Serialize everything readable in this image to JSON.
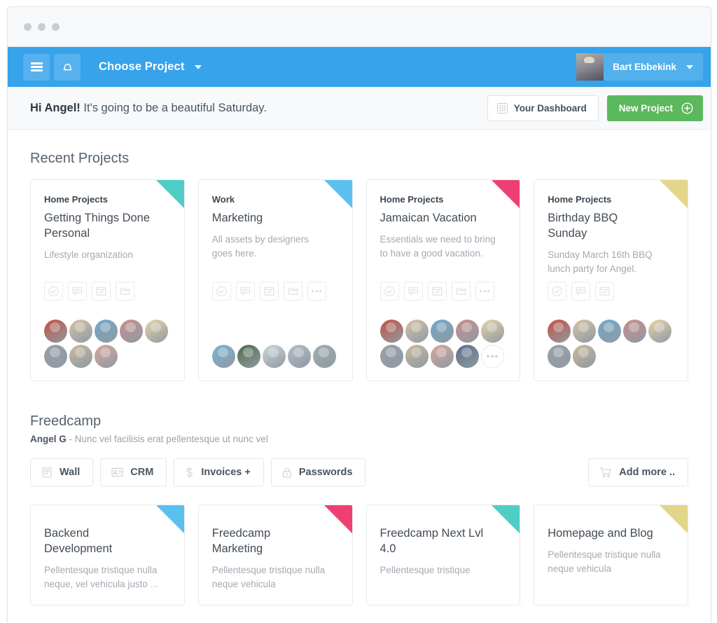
{
  "window": {
    "dots": [
      "minimize-dot",
      "maximize-dot",
      "close-dot"
    ]
  },
  "topbar": {
    "menu_icon": "hamburger-icon",
    "notifications_icon": "bell-icon",
    "choose_project_label": "Choose Project",
    "dropdown_icon": "chevron-down-icon",
    "user_name": "Bart Ebbekink",
    "user_caret_icon": "chevron-down-icon",
    "background_color": "#36a3eb"
  },
  "greeting": {
    "bold": "Hi Angel!",
    "rest": " It's going to be a beautiful Saturday.",
    "dashboard_button": {
      "label": "Your Dashboard",
      "icon": "grid-dots-icon"
    },
    "new_project_button": {
      "label": "New Project",
      "icon": "plus-circle-icon",
      "color": "#5cb85c"
    }
  },
  "recent_projects": {
    "title": "Recent Projects",
    "cards": [
      {
        "group": "Home Projects",
        "title": "Getting Things Done Personal",
        "desc": "Lifestyle organization",
        "ribbon_color": "#4ecdc4",
        "icons": [
          "check-circle-icon",
          "comment-icon",
          "task-icon",
          "folder-icon"
        ],
        "avatar_count": 8,
        "has_more_avatar": false,
        "avatar_colors": [
          "#c4503f",
          "#d8c3a5",
          "#6fa8c9",
          "#c98d8d",
          "#e8d4a8",
          "#9aa0a6",
          "#cbb89d",
          "#d6a89a"
        ]
      },
      {
        "group": "Work",
        "title": "Marketing",
        "desc": "All assets by designers goes here.",
        "ribbon_color": "#5bc0f0",
        "icons": [
          "check-circle-icon",
          "comment-icon",
          "task-icon",
          "folder-icon",
          "more-icon"
        ],
        "avatar_count": 5,
        "has_more_avatar": false,
        "avatar_colors": [
          "#7ab3d6",
          "#4e6b4a",
          "#cfd6dc",
          "#b6bcc4",
          "#9fb0ae"
        ]
      },
      {
        "group": "Home Projects",
        "title": "Jamaican Vacation",
        "desc": "Essentials we need to bring to have a good vacation.",
        "ribbon_color": "#ef3f72",
        "icons": [
          "check-circle-icon",
          "comment-icon",
          "task-icon",
          "folder-icon",
          "more-icon"
        ],
        "avatar_count": 9,
        "has_more_avatar": true,
        "avatar_colors": [
          "#c4503f",
          "#d8c3a5",
          "#6fa8c9",
          "#c98d8d",
          "#e8d4a8",
          "#9aa0a6",
          "#cbb89d",
          "#d6a89a",
          "#5b6d88"
        ]
      },
      {
        "group": "Home Projects",
        "title": "Birthday BBQ Sunday",
        "desc": "Sunday March 16th BBQ lunch party for Angel.",
        "ribbon_color": "#e3d68b",
        "icons": [
          "check-circle-icon",
          "comment-icon",
          "task-icon"
        ],
        "avatar_count": 7,
        "has_more_avatar": false,
        "avatar_colors": [
          "#c4503f",
          "#d8c3a5",
          "#6fa8c9",
          "#c98d8d",
          "#e8d4a8",
          "#9aa0a6",
          "#cbb89d"
        ]
      }
    ]
  },
  "freedcamp": {
    "title": "Freedcamp",
    "owner": "Angel G",
    "owner_desc": " - Nunc vel facilisis erat pellentesque ut nunc vel",
    "apps": [
      {
        "label": "Wall",
        "icon": "wall-icon"
      },
      {
        "label": "CRM",
        "icon": "crm-card-icon"
      },
      {
        "label": "Invoices +",
        "icon": "dollar-icon"
      },
      {
        "label": "Passwords",
        "icon": "lock-icon"
      }
    ],
    "add_more": {
      "label": "Add more ..",
      "icon": "cart-icon"
    },
    "cards": [
      {
        "title": "Backend Development",
        "desc": "Pellentesque tristique nulla neque, vel vehicula justo ",
        "desc_ellipsis": "...",
        "ribbon_color": "#5bc0f0"
      },
      {
        "title": "Freedcamp Marketing",
        "desc": "Pellentesque tristique nulla neque vehicula",
        "desc_ellipsis": "",
        "ribbon_color": "#ef3f72"
      },
      {
        "title": "Freedcamp Next Lvl 4.0",
        "desc": "Pellentesque tristique",
        "desc_ellipsis": "",
        "ribbon_color": "#4ecdc4"
      },
      {
        "title": "Homepage and Blog",
        "desc": "Pellentesque tristique nulla neque vehicula",
        "desc_ellipsis": "",
        "ribbon_color": "#e3d68b"
      }
    ]
  }
}
